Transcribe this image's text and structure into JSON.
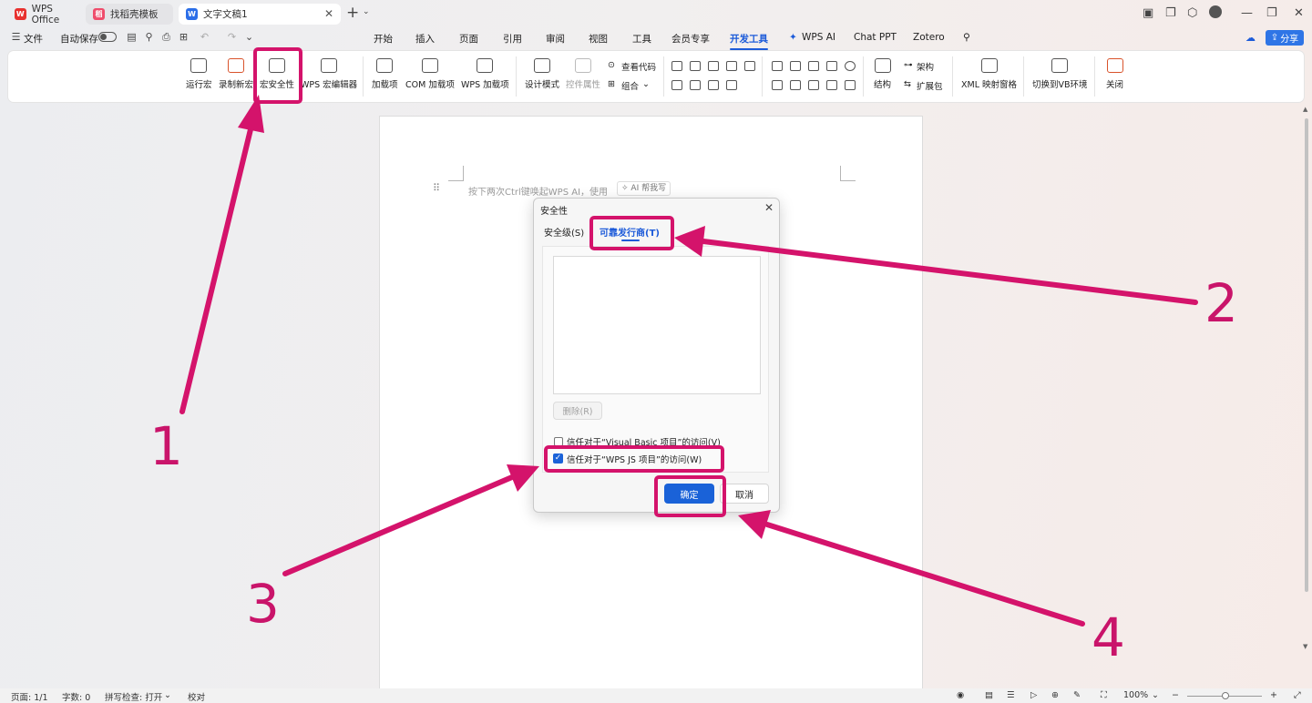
{
  "tabbar": {
    "tabs": [
      {
        "label": "WPS Office"
      },
      {
        "label": "找稻壳模板"
      },
      {
        "label": "文字文稿1"
      }
    ],
    "new_tab": "+"
  },
  "menu": {
    "file_label": "文件",
    "autosave_label": "自动保存",
    "items": [
      "开始",
      "插入",
      "页面",
      "引用",
      "审阅",
      "视图",
      "工具",
      "会员专享",
      "开发工具",
      "WPS AI",
      "Chat PPT",
      "Zotero"
    ],
    "share_label": "分享"
  },
  "ribbon": {
    "run_macro": "运行宏",
    "record_macro": "录制新宏",
    "macro_security": "宏安全性",
    "wps_macro_editor": "WPS 宏编辑器",
    "addins": "加载项",
    "com_addins": "COM 加载项",
    "wps_addins": "WPS 加载项",
    "design_mode": "设计模式",
    "control_props": "控件属性",
    "view_code": "查看代码",
    "group": "组合",
    "structure": "结构",
    "schema": "架构",
    "expansion_pack": "扩展包",
    "xml_pane": "XML 映射窗格",
    "switch_vb": "切换到VB环境",
    "close": "关闭"
  },
  "document": {
    "hint": "按下两次Ctrl键唤起WPS AI，使用",
    "ai_chip": "AI 帮我写"
  },
  "dialog": {
    "title": "安全性",
    "tab_security_level": "安全级(S)",
    "tab_trusted_publishers": "可靠发行商(T)",
    "delete_button": "删除(R)",
    "trust_vba_label": "信任对于“Visual Basic 项目”的访问(V)",
    "trust_vba_checked": false,
    "trust_js_label": "信任对于“WPS JS 项目”的访问(W)",
    "trust_js_checked": true,
    "ok_button": "确定",
    "cancel_button": "取消"
  },
  "status": {
    "page": "页面: 1/1",
    "words": "字数: 0",
    "spellcheck": "拼写检查: 打开",
    "proof": "校对",
    "zoom": "100%"
  },
  "annotations": {
    "numbers": [
      "1",
      "2",
      "3",
      "4"
    ],
    "color": "#d4136b"
  },
  "colors": {
    "accent": "#1d5bd9",
    "wps_red": "#e8312f",
    "ok_blue": "#1a62d8"
  }
}
